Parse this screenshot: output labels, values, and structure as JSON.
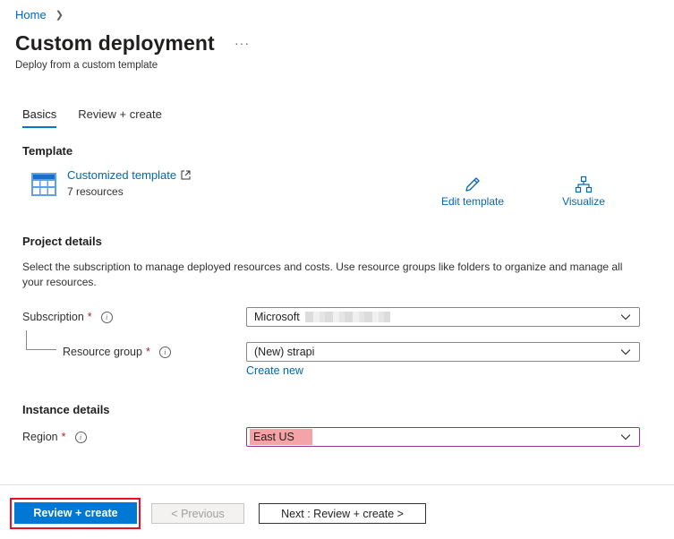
{
  "breadcrumb": {
    "home": "Home"
  },
  "header": {
    "title": "Custom deployment",
    "more": "···",
    "subtitle": "Deploy from a custom template"
  },
  "tabs": [
    {
      "label": "Basics",
      "active": true
    },
    {
      "label": "Review + create",
      "active": false
    }
  ],
  "template": {
    "section_title": "Template",
    "name": "Customized template",
    "count": "7 resources",
    "edit_label": "Edit template",
    "visualize_label": "Visualize"
  },
  "project": {
    "section_title": "Project details",
    "description": "Select the subscription to manage deployed resources and costs. Use resource groups like folders to organize and manage all your resources.",
    "subscription_label": "Subscription",
    "subscription_value": "Microsoft",
    "resource_group_label": "Resource group",
    "resource_group_value": "(New) strapi",
    "create_new": "Create new"
  },
  "instance": {
    "section_title": "Instance details",
    "region_label": "Region",
    "region_value": "East US"
  },
  "required_mark": "*",
  "footer": {
    "review_create": "Review + create",
    "previous": "< Previous",
    "next": "Next : Review + create >"
  },
  "colors": {
    "accent": "#0078d4",
    "link": "#0067b8",
    "required": "#a4262c",
    "highlight": "#e81123"
  }
}
